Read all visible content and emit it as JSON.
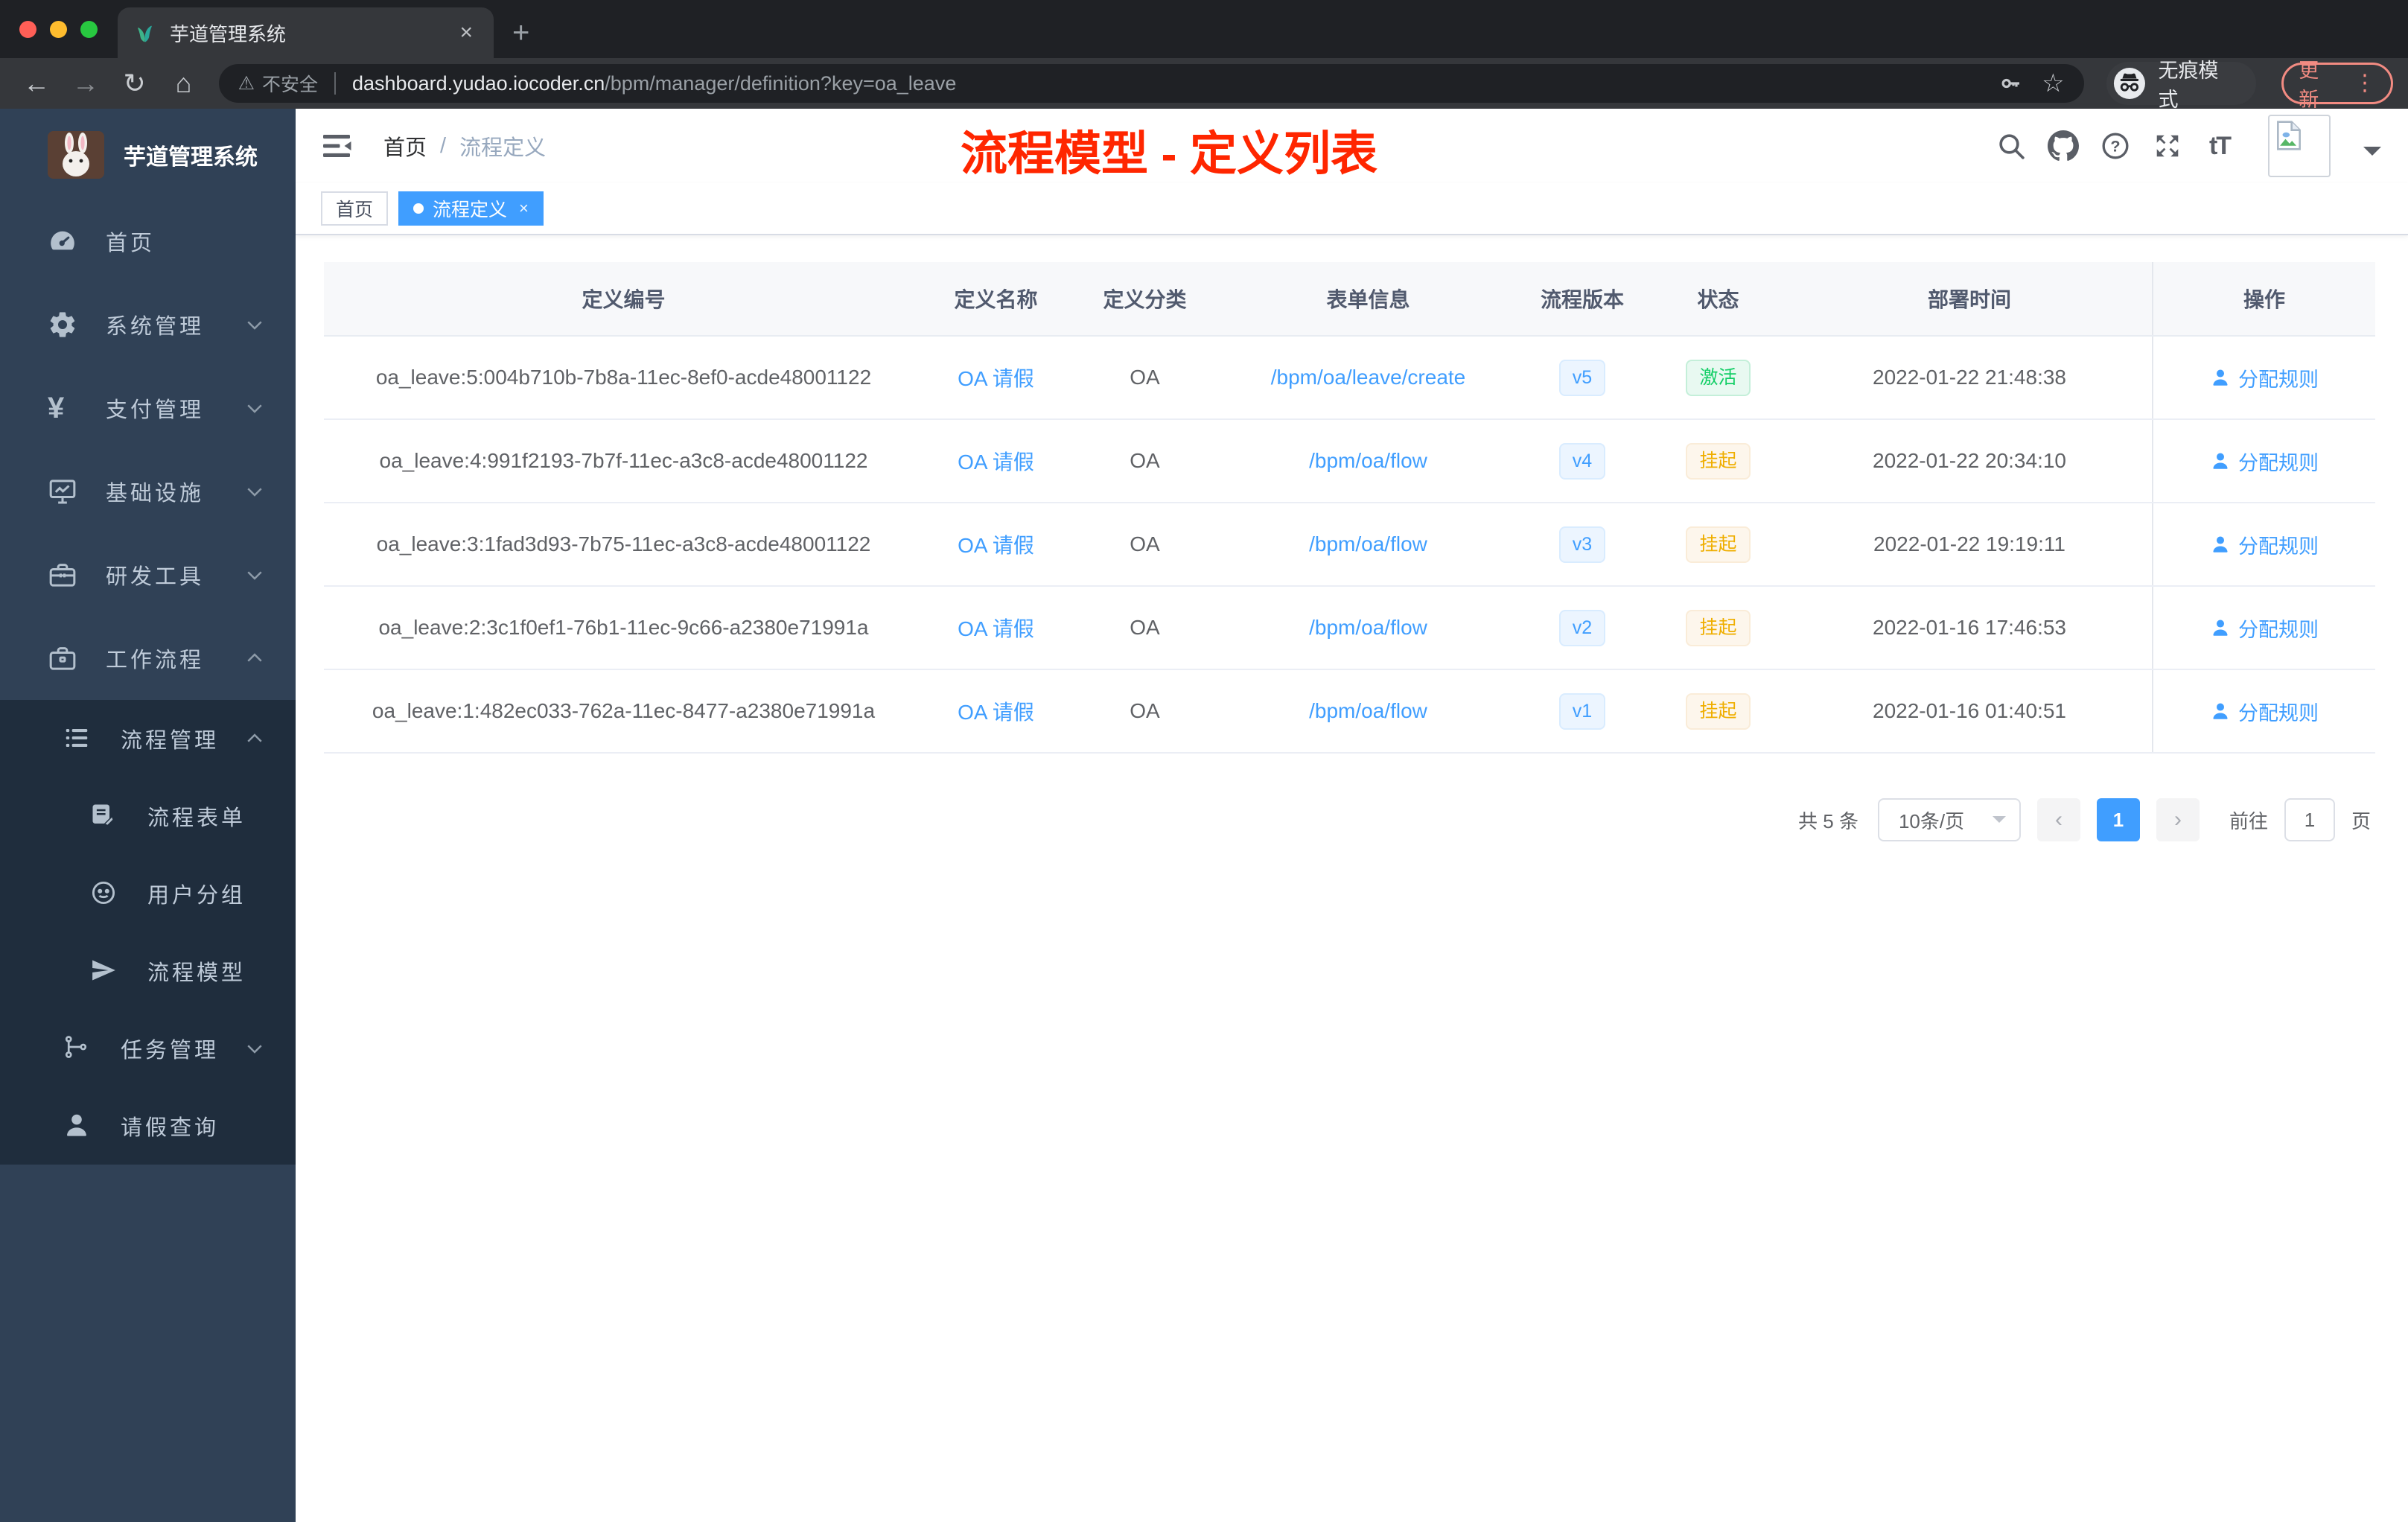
{
  "browser": {
    "tab_title": "芋道管理系统",
    "tab_close": "×",
    "new_tab": "+",
    "back": "←",
    "forward": "→",
    "reload": "↻",
    "home": "⌂",
    "security_label": "不安全",
    "warning_glyph": "⚠",
    "url_host": "dashboard.yudao.iocoder.cn",
    "url_path": "/bpm/manager/definition?key=oa_leave",
    "star_glyph": "☆",
    "incognito_label": "无痕模式",
    "update_label": "更新",
    "update_dots": "⋮"
  },
  "sidebar": {
    "logo_title": "芋道管理系统",
    "items": [
      {
        "label": "首页",
        "icon": "gauge-icon",
        "level": 1,
        "chevron": null,
        "submenu": false
      },
      {
        "label": "系统管理",
        "icon": "gear-icon",
        "level": 1,
        "chevron": "down",
        "submenu": false
      },
      {
        "label": "支付管理",
        "icon": "yen-icon",
        "level": 1,
        "chevron": "down",
        "submenu": false
      },
      {
        "label": "基础设施",
        "icon": "monitor-icon",
        "level": 1,
        "chevron": "down",
        "submenu": false
      },
      {
        "label": "研发工具",
        "icon": "toolbox-icon",
        "level": 1,
        "chevron": "down",
        "submenu": false
      },
      {
        "label": "工作流程",
        "icon": "briefcase-icon",
        "level": 1,
        "chevron": "up",
        "submenu": false
      },
      {
        "label": "流程管理",
        "icon": "list-icon",
        "level": 2,
        "chevron": "up",
        "submenu": true
      },
      {
        "label": "流程表单",
        "icon": "form-icon",
        "level": 3,
        "chevron": null,
        "submenu": true
      },
      {
        "label": "用户分组",
        "icon": "group-icon",
        "level": 3,
        "chevron": null,
        "submenu": true
      },
      {
        "label": "流程模型",
        "icon": "model-icon",
        "level": 3,
        "chevron": null,
        "submenu": true
      },
      {
        "label": "任务管理",
        "icon": "task-icon",
        "level": 2,
        "chevron": "down",
        "submenu": true
      },
      {
        "label": "请假查询",
        "icon": "user-icon",
        "level": 2,
        "chevron": null,
        "submenu": true
      }
    ]
  },
  "header": {
    "breadcrumb": [
      "首页",
      "流程定义"
    ],
    "breadcrumb_separator": "/",
    "annotation": "流程模型 - 定义列表",
    "right_icons": [
      "search-icon",
      "github-icon",
      "help-icon",
      "fullscreen-icon",
      "font-size-icon"
    ],
    "font_size_glyph": "tT"
  },
  "tags": [
    {
      "label": "首页",
      "active": false,
      "closable": false
    },
    {
      "label": "流程定义",
      "active": true,
      "closable": true,
      "close_glyph": "×"
    }
  ],
  "table": {
    "columns": [
      "定义编号",
      "定义名称",
      "定义分类",
      "表单信息",
      "流程版本",
      "状态",
      "部署时间",
      "操作"
    ],
    "rows": [
      {
        "id": "oa_leave:5:004b710b-7b8a-11ec-8ef0-acde48001122",
        "name": "OA 请假",
        "category": "OA",
        "form": "/bpm/oa/leave/create",
        "version": "v5",
        "status": "激活",
        "status_type": "active",
        "deployed_at": "2022-01-22 21:48:38",
        "action": "分配规则"
      },
      {
        "id": "oa_leave:4:991f2193-7b7f-11ec-a3c8-acde48001122",
        "name": "OA 请假",
        "category": "OA",
        "form": "/bpm/oa/flow",
        "version": "v4",
        "status": "挂起",
        "status_type": "suspend",
        "deployed_at": "2022-01-22 20:34:10",
        "action": "分配规则"
      },
      {
        "id": "oa_leave:3:1fad3d93-7b75-11ec-a3c8-acde48001122",
        "name": "OA 请假",
        "category": "OA",
        "form": "/bpm/oa/flow",
        "version": "v3",
        "status": "挂起",
        "status_type": "suspend",
        "deployed_at": "2022-01-22 19:19:11",
        "action": "分配规则"
      },
      {
        "id": "oa_leave:2:3c1f0ef1-76b1-11ec-9c66-a2380e71991a",
        "name": "OA 请假",
        "category": "OA",
        "form": "/bpm/oa/flow",
        "version": "v2",
        "status": "挂起",
        "status_type": "suspend",
        "deployed_at": "2022-01-16 17:46:53",
        "action": "分配规则"
      },
      {
        "id": "oa_leave:1:482ec033-762a-11ec-8477-a2380e71991a",
        "name": "OA 请假",
        "category": "OA",
        "form": "/bpm/oa/flow",
        "version": "v1",
        "status": "挂起",
        "status_type": "suspend",
        "deployed_at": "2022-01-16 01:40:51",
        "action": "分配规则"
      }
    ]
  },
  "pagination": {
    "total_label": "共 5 条",
    "page_size": "10条/页",
    "prev_glyph": "‹",
    "next_glyph": "›",
    "current_page": "1",
    "goto_label": "前往",
    "goto_value": "1",
    "page_suffix": "页"
  },
  "colors": {
    "accent_blue": "#409eff",
    "sidebar_bg": "#304156",
    "submenu_bg": "#1f2d3d",
    "annotation_red": "#ff2600",
    "status_active_green": "#13ce66",
    "status_suspend_yellow": "#efae00"
  }
}
